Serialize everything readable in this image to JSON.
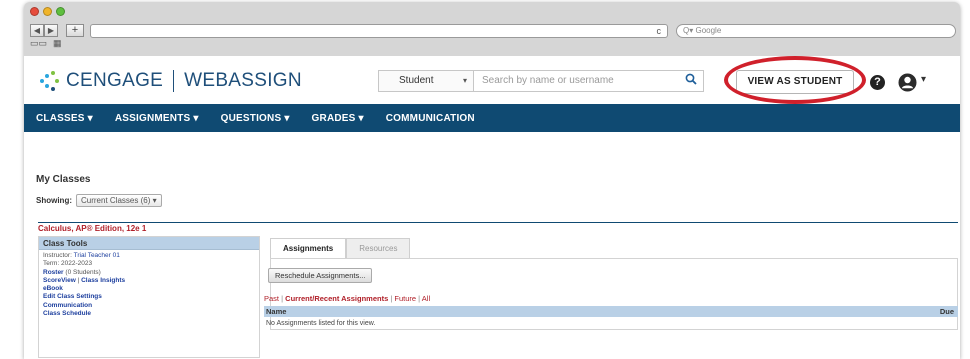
{
  "browser": {
    "search_placeholder": "Google",
    "reload_glyph": "c"
  },
  "app": {
    "brand_left": "CENGAGE",
    "brand_right": "WEBASSIGN",
    "role_select": "Student",
    "search_placeholder": "Search by name or username",
    "view_as_student": "VIEW AS STUDENT",
    "help_glyph": "?",
    "accent_color": "#0f4a72",
    "highlight_color": "#d0202b"
  },
  "nav": {
    "items": [
      {
        "label": "CLASSES",
        "caret": "▾"
      },
      {
        "label": "ASSIGNMENTS",
        "caret": "▾"
      },
      {
        "label": "QUESTIONS",
        "caret": "▾"
      },
      {
        "label": "GRADES",
        "caret": "▾"
      },
      {
        "label": "COMMUNICATION",
        "caret": ""
      }
    ]
  },
  "main": {
    "heading": "My Classes",
    "showing_label": "Showing:",
    "showing_value": "Current Classes (6)",
    "class_title": "Calculus, AP® Edition, 12e 1",
    "tools": {
      "header": "Class Tools",
      "instructor_label": "Instructor:",
      "instructor_name": "Trial Teacher 01",
      "term": "Term: 2022-2023",
      "roster": "Roster",
      "roster_count": "(0 Students)",
      "scoreview": "ScoreView",
      "class_insights": "Class Insights",
      "ebook": "eBook",
      "edit_settings": "Edit Class Settings",
      "communication": "Communication",
      "schedule": "Class Schedule"
    },
    "tabs": [
      "Assignments",
      "Resources"
    ],
    "reschedule": "Reschedule Assignments...",
    "filters": {
      "past": "Past",
      "current": "Current/Recent Assignments",
      "future": "Future",
      "all": "All"
    },
    "table": {
      "col_name": "Name",
      "col_due": "Due",
      "empty": "No Assignments listed for this view."
    }
  }
}
